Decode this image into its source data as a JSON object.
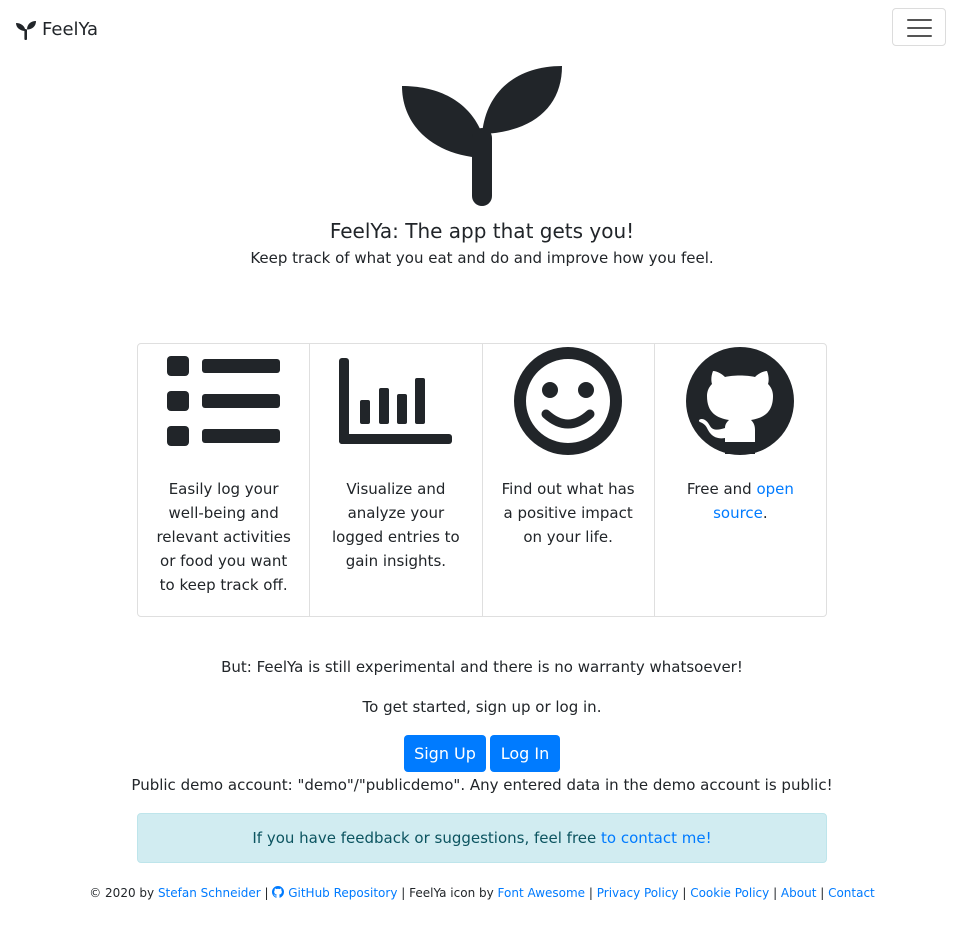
{
  "navbar": {
    "brand": "FeelYa",
    "menu_icon": "hamburger-icon"
  },
  "hero": {
    "logo_icon": "seedling-icon",
    "title": "FeelYa: The app that gets you!",
    "subtitle": "Keep track of what you eat and do and improve how you feel."
  },
  "features": [
    {
      "icon": "list-icon",
      "text": "Easily log your well-being and relevant activities or food you want to keep track off."
    },
    {
      "icon": "bar-chart-icon",
      "text": "Visualize and analyze your logged entries to gain insights."
    },
    {
      "icon": "smile-icon",
      "text": "Find out what has a positive impact on your life."
    },
    {
      "icon": "github-icon",
      "text_before": "Free and ",
      "link": "open source",
      "text_after": "."
    }
  ],
  "warning": "But: FeelYa is still experimental and there is no warranty whatsoever!",
  "get_started": "To get started, sign up or log in.",
  "buttons": {
    "signup": "Sign Up",
    "login": "Log In"
  },
  "demo": "Public demo account: \"demo\"/\"publicdemo\". Any entered data in the demo account is public!",
  "feedback": {
    "text": "If you have feedback or suggestions, feel free ",
    "link": "to contact me!"
  },
  "footer": {
    "copyright": "© 2020 by ",
    "author": "Stefan Schneider",
    "sep": " | ",
    "github_icon": "github-icon",
    "github": "GitHub Repository",
    "icon_by": "FeelYa icon by ",
    "font_awesome": "Font Awesome",
    "privacy": "Privacy Policy",
    "cookie": "Cookie Policy",
    "about": "About",
    "contact": "Contact"
  },
  "colors": {
    "link": "#007bff",
    "text": "#212529",
    "alert_bg": "#d1ecf1",
    "alert_text": "#0c5460"
  }
}
